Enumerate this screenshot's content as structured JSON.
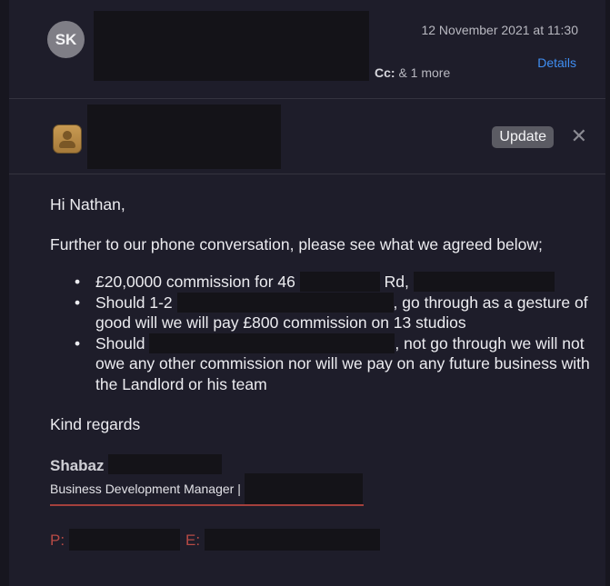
{
  "header": {
    "avatar_initials": "SK",
    "date": "12 November 2021 at 11:30",
    "details_label": "Details",
    "cc_label": "Cc:",
    "cc_value": "& 1 more"
  },
  "banner": {
    "icon": "contacts-card-icon",
    "update_label": "Update",
    "close_icon": "close-icon",
    "close_glyph": "✕"
  },
  "message": {
    "greeting": "Hi Nathan,",
    "intro": "Further to our phone conversation, please see what we agreed below;",
    "points": [
      {
        "part1": "£20,0000 commission for 46",
        "part2": "Rd,",
        "part3": ""
      },
      {
        "part1": "Should 1-2",
        "part2": ", go through as a gesture of good will we will pay £800 commission on 13 studios",
        "part3": ""
      },
      {
        "part1": "Should",
        "part2": ", not go through we will not owe any other commission nor will we pay on any future business with the Landlord or his team",
        "part3": ""
      }
    ],
    "closing": "Kind regards"
  },
  "signature": {
    "name": "Shabaz",
    "title": "Business Development Manager |",
    "phone_label": "P:",
    "email_label": "E:"
  },
  "colors": {
    "background": "#1e1d2a",
    "link": "#3f8ef2",
    "signature_accent": "#b64a45"
  }
}
